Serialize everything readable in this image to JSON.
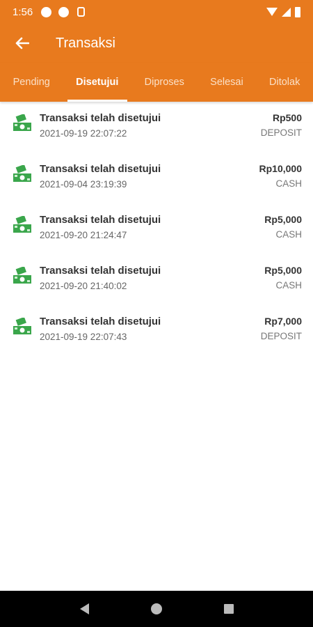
{
  "statusbar": {
    "time": "1:56"
  },
  "header": {
    "title": "Transaksi"
  },
  "tabs": [
    {
      "label": "Pending",
      "active": false
    },
    {
      "label": "Disetujui",
      "active": true
    },
    {
      "label": "Diproses",
      "active": false
    },
    {
      "label": "Selesai",
      "active": false
    },
    {
      "label": "Ditolak",
      "active": false
    }
  ],
  "transactions": [
    {
      "title": "Transaksi telah disetujui",
      "date": "2021-09-19 22:07:22",
      "amount": "Rp500",
      "type": "DEPOSIT"
    },
    {
      "title": "Transaksi telah disetujui",
      "date": "2021-09-04 23:19:39",
      "amount": "Rp10,000",
      "type": "CASH"
    },
    {
      "title": "Transaksi telah disetujui",
      "date": "2021-09-20 21:24:47",
      "amount": "Rp5,000",
      "type": "CASH"
    },
    {
      "title": "Transaksi telah disetujui",
      "date": "2021-09-20 21:40:02",
      "amount": "Rp5,000",
      "type": "CASH"
    },
    {
      "title": "Transaksi telah disetujui",
      "date": "2021-09-19 22:07:43",
      "amount": "Rp7,000",
      "type": "DEPOSIT"
    }
  ],
  "colors": {
    "primary": "#e87a1e",
    "money_icon": "#3aa64b"
  }
}
